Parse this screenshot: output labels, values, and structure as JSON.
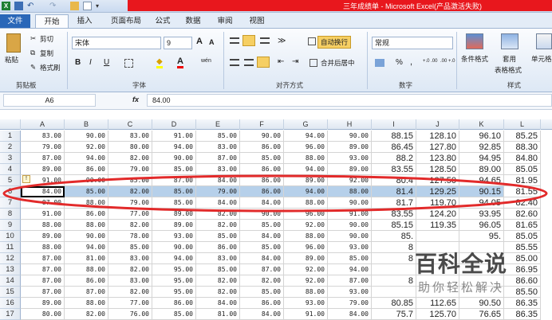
{
  "title": "三年成绩单 - Microsoft Excel(产品激活失败)",
  "menu": {
    "file": "文件",
    "tabs": [
      "开始",
      "插入",
      "页面布局",
      "公式",
      "数据",
      "审阅",
      "视图"
    ]
  },
  "ribbon": {
    "paste": "粘贴",
    "cut": "剪切",
    "copy": "复制",
    "format_painter": "格式刷",
    "clipboard": "剪贴板",
    "font_name": "宋体",
    "font_size": "9",
    "bold": "B",
    "italic": "I",
    "underline": "U",
    "font_group": "字体",
    "wrap_text": "自动换行",
    "merge_center": "合并后居中",
    "alignment_group": "对齐方式",
    "number_format": "常规",
    "percent": "%",
    "comma": ",",
    "dec_inc": "+.0 .00",
    "dec_dec": ".00 +.0",
    "number_group": "数字",
    "conditional_format": "条件格式",
    "table_format_1": "套用",
    "table_format_2": "表格格式",
    "cell_styles": "单元格",
    "styles_group": "样式",
    "grow_font": "A",
    "shrink_font": "A",
    "font_color": "A",
    "fill_color": "◆",
    "wen": "wén"
  },
  "formula_bar": {
    "name_box": "A6",
    "fx": "fx",
    "value": "84.00"
  },
  "grid": {
    "columns": [
      "A",
      "B",
      "C",
      "D",
      "E",
      "F",
      "G",
      "H",
      "I",
      "J",
      "K",
      "L"
    ],
    "rows": [
      {
        "n": "1",
        "c": [
          "83.00",
          "90.00",
          "83.00",
          "91.00",
          "85.00",
          "90.00",
          "94.00",
          "90.00",
          "88.15",
          "128.10",
          "96.10",
          "85.25"
        ]
      },
      {
        "n": "2",
        "c": [
          "79.00",
          "92.00",
          "80.00",
          "94.00",
          "83.00",
          "86.00",
          "96.00",
          "89.00",
          "86.45",
          "127.80",
          "92.85",
          "88.30"
        ]
      },
      {
        "n": "3",
        "c": [
          "87.00",
          "94.00",
          "82.00",
          "90.00",
          "87.00",
          "85.00",
          "88.00",
          "93.00",
          "88.2",
          "123.80",
          "94.95",
          "84.80"
        ]
      },
      {
        "n": "4",
        "c": [
          "89.00",
          "86.00",
          "79.00",
          "85.00",
          "83.00",
          "86.00",
          "94.00",
          "89.00",
          "83.55",
          "128.50",
          "89.00",
          "85.05"
        ]
      },
      {
        "n": "5",
        "c": [
          "91.00",
          "90.00",
          "85.00",
          "87.00",
          "84.00",
          "86.00",
          "89.00",
          "92.00",
          "80.4",
          "127.50",
          "94.65",
          "81.95"
        ]
      },
      {
        "n": "6",
        "c": [
          "84.00",
          "85.00",
          "82.00",
          "85.00",
          "79.00",
          "86.00",
          "94.00",
          "88.00",
          "81.4",
          "129.25",
          "90.15",
          "81.55"
        ]
      },
      {
        "n": "7",
        "c": [
          "87.00",
          "88.00",
          "79.00",
          "85.00",
          "84.00",
          "84.00",
          "88.00",
          "90.00",
          "81.7",
          "119.70",
          "94.05",
          "82.40"
        ]
      },
      {
        "n": "8",
        "c": [
          "91.00",
          "86.00",
          "77.00",
          "89.00",
          "82.00",
          "90.00",
          "96.00",
          "91.00",
          "83.55",
          "124.20",
          "93.95",
          "82.60"
        ]
      },
      {
        "n": "9",
        "c": [
          "88.00",
          "88.00",
          "82.00",
          "89.00",
          "82.00",
          "85.00",
          "92.00",
          "90.00",
          "85.15",
          "119.35",
          "96.05",
          "81.65"
        ]
      },
      {
        "n": "10",
        "c": [
          "89.00",
          "90.00",
          "78.00",
          "93.00",
          "85.00",
          "84.00",
          "88.00",
          "90.00",
          "85.",
          "",
          "95.",
          "85.05"
        ]
      },
      {
        "n": "11",
        "c": [
          "88.00",
          "94.00",
          "85.00",
          "90.00",
          "86.00",
          "85.00",
          "96.00",
          "93.00",
          "8",
          "",
          "",
          "85.55"
        ]
      },
      {
        "n": "12",
        "c": [
          "87.00",
          "81.00",
          "83.00",
          "94.00",
          "83.00",
          "84.00",
          "89.00",
          "85.00",
          "8",
          "",
          "",
          "85.00"
        ]
      },
      {
        "n": "13",
        "c": [
          "87.00",
          "88.00",
          "82.00",
          "95.00",
          "85.00",
          "87.00",
          "92.00",
          "94.00",
          "",
          "",
          "",
          "86.95"
        ]
      },
      {
        "n": "14",
        "c": [
          "87.00",
          "86.00",
          "83.00",
          "95.00",
          "82.00",
          "82.00",
          "92.00",
          "87.00",
          "8",
          "",
          "",
          "86.60"
        ]
      },
      {
        "n": "15",
        "c": [
          "87.00",
          "87.00",
          "82.00",
          "95.00",
          "82.00",
          "85.00",
          "88.00",
          "93.00",
          "",
          "",
          "",
          "85.50"
        ]
      },
      {
        "n": "16",
        "c": [
          "89.00",
          "88.00",
          "77.00",
          "86.00",
          "84.00",
          "86.00",
          "93.00",
          "79.00",
          "80.85",
          "112.65",
          "90.50",
          "86.35"
        ]
      },
      {
        "n": "17",
        "c": [
          "80.00",
          "82.00",
          "76.00",
          "85.00",
          "81.00",
          "84.00",
          "91.00",
          "84.00",
          "75.7",
          "125.70",
          "76.65",
          "86.35"
        ]
      }
    ]
  },
  "watermark": {
    "brand": "百科全说",
    "sub": "助你轻松解决"
  }
}
